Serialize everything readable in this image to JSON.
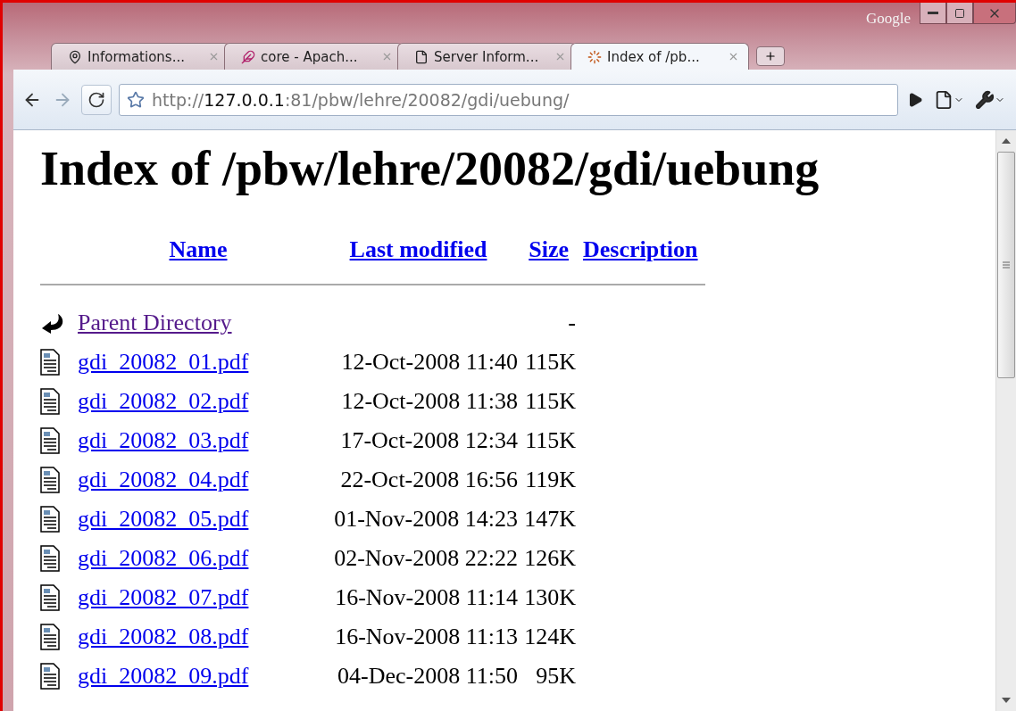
{
  "window": {
    "brand": "Google"
  },
  "tabs": [
    {
      "title": "Informations...",
      "selected": false
    },
    {
      "title": "core - Apach...",
      "selected": false
    },
    {
      "title": "Server Inform...",
      "selected": false
    },
    {
      "title": "Index of /pb...",
      "selected": true
    }
  ],
  "address_bar": {
    "scheme": "http://",
    "host": "127.0.0.1",
    "rest": ":81/pbw/lehre/20082/gdi/uebung/"
  },
  "page": {
    "heading": "Index of /pbw/lehre/20082/gdi/uebung",
    "columns": [
      "Name",
      "Last modified",
      "Size",
      "Description"
    ],
    "rows": [
      {
        "kind": "parent",
        "name": "Parent Directory",
        "modified": "",
        "size": "-",
        "visited": true
      },
      {
        "kind": "file",
        "name": "gdi_20082_01.pdf",
        "modified": "12-Oct-2008 11:40",
        "size": "115K",
        "visited": false
      },
      {
        "kind": "file",
        "name": "gdi_20082_02.pdf",
        "modified": "12-Oct-2008 11:38",
        "size": "115K",
        "visited": false
      },
      {
        "kind": "file",
        "name": "gdi_20082_03.pdf",
        "modified": "17-Oct-2008 12:34",
        "size": "115K",
        "visited": false
      },
      {
        "kind": "file",
        "name": "gdi_20082_04.pdf",
        "modified": "22-Oct-2008 16:56",
        "size": "119K",
        "visited": false
      },
      {
        "kind": "file",
        "name": "gdi_20082_05.pdf",
        "modified": "01-Nov-2008 14:23",
        "size": "147K",
        "visited": false
      },
      {
        "kind": "file",
        "name": "gdi_20082_06.pdf",
        "modified": "02-Nov-2008 22:22",
        "size": "126K",
        "visited": false
      },
      {
        "kind": "file",
        "name": "gdi_20082_07.pdf",
        "modified": "16-Nov-2008 11:14",
        "size": "130K",
        "visited": false
      },
      {
        "kind": "file",
        "name": "gdi_20082_08.pdf",
        "modified": "16-Nov-2008 11:13",
        "size": "124K",
        "visited": false
      },
      {
        "kind": "file",
        "name": "gdi_20082_09.pdf",
        "modified": "04-Dec-2008 11:50",
        "size": "95K",
        "visited": false
      }
    ]
  }
}
